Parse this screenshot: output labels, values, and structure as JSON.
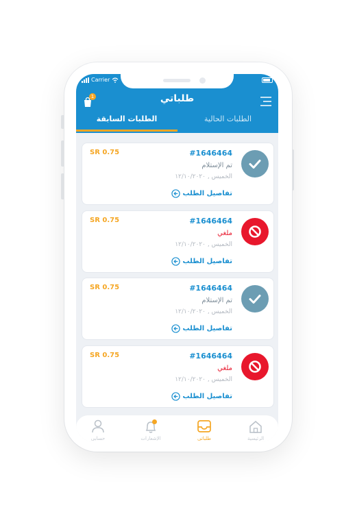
{
  "status_bar": {
    "carrier": "Carrier"
  },
  "header": {
    "title": "طلباتي",
    "cart_badge": "1",
    "tabs": [
      {
        "label": "الطلبات السابقة",
        "active": true
      },
      {
        "label": "الطلبات الحالية",
        "active": false
      }
    ]
  },
  "orders": [
    {
      "id": "#1646464",
      "status": "تم الإستلام",
      "status_type": "received",
      "date": "الخميس , ١٢/١٠/٢٠٢٠",
      "details_label": "تفاصيل الطلب",
      "price": "SR 0.75",
      "icon": "check-icon"
    },
    {
      "id": "#1646464",
      "status": "ملغي",
      "status_type": "cancelled",
      "date": "الخميس , ١٢/١٠/٢٠٢٠",
      "details_label": "تفاصيل الطلب",
      "price": "SR 0.75",
      "icon": "ban-icon"
    },
    {
      "id": "#1646464",
      "status": "تم الإستلام",
      "status_type": "received",
      "date": "الخميس , ١٢/١٠/٢٠٢٠",
      "details_label": "تفاصيل الطلب",
      "price": "SR 0.75",
      "icon": "check-icon"
    },
    {
      "id": "#1646464",
      "status": "ملغي",
      "status_type": "cancelled",
      "date": "الخميس , ١٢/١٠/٢٠٢٠",
      "details_label": "تفاصيل الطلب",
      "price": "SR 0.75",
      "icon": "ban-icon"
    }
  ],
  "bottom_nav": [
    {
      "label": "حسابي",
      "icon": "user-icon",
      "active": false
    },
    {
      "label": "الإشعارات",
      "icon": "bell-icon",
      "active": false
    },
    {
      "label": "طلباتي",
      "icon": "inbox-icon",
      "active": true
    },
    {
      "label": "الرئيسية",
      "icon": "home-icon",
      "active": false
    }
  ],
  "colors": {
    "primary": "#1a8fd0",
    "accent": "#f5a623",
    "received": "#6c9db3",
    "cancelled": "#e8172c"
  }
}
